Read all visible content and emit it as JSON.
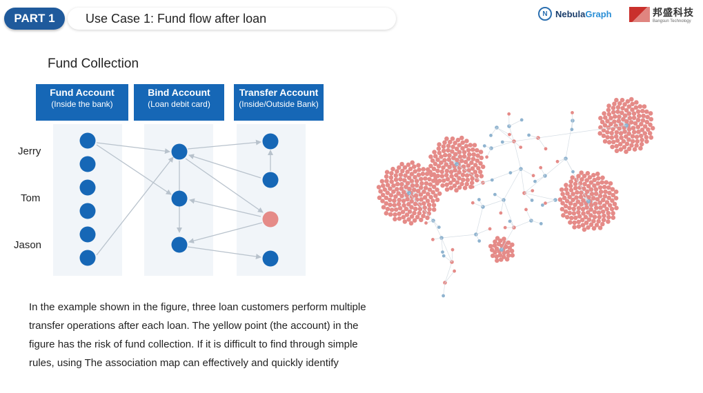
{
  "header": {
    "part_label": "PART 1",
    "title": "Use Case 1: Fund flow after loan"
  },
  "logos": {
    "nebula_name_a": "Nebula",
    "nebula_name_b": "Graph",
    "bs_cn": "邦盛科技",
    "bs_en": "Bangsun Technology"
  },
  "section_title": "Fund Collection",
  "columns": [
    {
      "title": "Fund Account",
      "subtitle": "(Inside the bank)"
    },
    {
      "title": "Bind Account",
      "subtitle": "(Loan debit card)"
    },
    {
      "title": "Transfer Account",
      "subtitle": "(Inside/Outside Bank)"
    }
  ],
  "rows": [
    "Jerry",
    "Tom",
    "Jason"
  ],
  "paragraph": "In the example shown in the figure, three loan customers perform multiple transfer operations after each loan. The yellow point (the account) in the figure has the risk of fund collection. If it is difficult to find through simple rules, using The association map can effectively and quickly identify",
  "colors": {
    "blue_node": "#1667b6",
    "risk_node": "#e58b88",
    "edge": "#b8c2cc",
    "cluster_node": "#e58b88",
    "hub_node": "#8fb3cf"
  }
}
